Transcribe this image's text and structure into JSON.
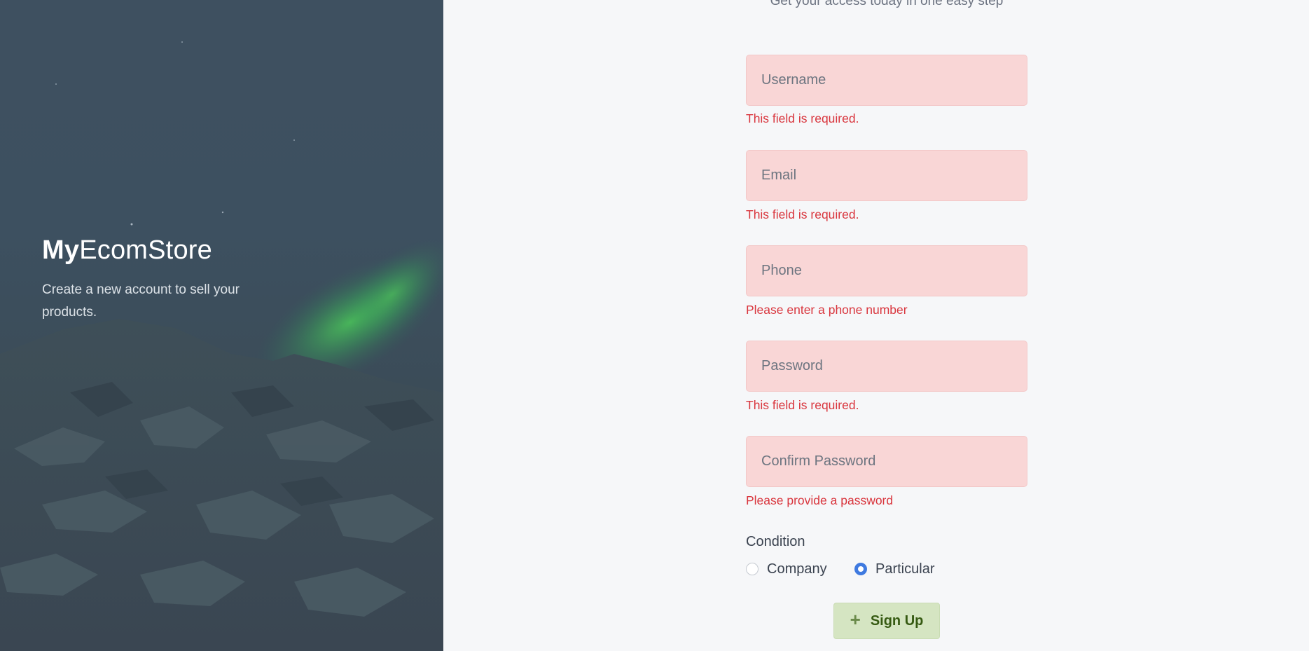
{
  "hero": {
    "brand_bold": "My",
    "brand_rest": "EcomStore",
    "tagline": "Create a new account to sell your products."
  },
  "form": {
    "subtitle": "Get your access today in one easy step",
    "fields": [
      {
        "placeholder": "Username",
        "value": "",
        "error": "This field is required."
      },
      {
        "placeholder": "Email",
        "value": "",
        "error": "This field is required."
      },
      {
        "placeholder": "Phone",
        "value": "",
        "error": "Please enter a phone number"
      },
      {
        "placeholder": "Password",
        "value": "",
        "error": "This field is required."
      },
      {
        "placeholder": "Confirm Password",
        "value": "",
        "error": "Please provide a password"
      }
    ],
    "condition": {
      "label": "Condition",
      "options": [
        "Company",
        "Particular"
      ],
      "selected": "Particular"
    },
    "submit": {
      "label": "Sign Up",
      "icon": "plus-icon"
    }
  },
  "colors": {
    "field_bg": "#f9d6d6",
    "error_text": "#d9363e",
    "radio_accent": "#3f7ae0",
    "button_bg": "#d5e5c2",
    "button_text": "#365a12"
  }
}
